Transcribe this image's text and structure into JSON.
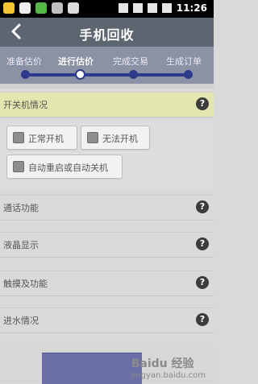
{
  "status_bar": {
    "time": "11:26",
    "left_icons": [
      "app-icon",
      "mail-icon",
      "app-icon",
      "android-icon",
      "usb-icon"
    ],
    "right_icons": [
      "bluetooth-icon",
      "wifi-icon",
      "sim-icon",
      "battery-icon"
    ]
  },
  "header": {
    "title": "手机回收"
  },
  "steps": {
    "items": [
      {
        "label": "准备估价",
        "active": false
      },
      {
        "label": "进行估价",
        "active": true
      },
      {
        "label": "完成交易",
        "active": false
      },
      {
        "label": "生成订单",
        "active": false
      }
    ]
  },
  "sections": [
    {
      "title": "开关机情况",
      "open": true
    },
    {
      "title": "通话功能",
      "open": false
    },
    {
      "title": "液晶显示",
      "open": false
    },
    {
      "title": "触摸及功能",
      "open": false
    },
    {
      "title": "进水情况",
      "open": false
    }
  ],
  "power_options": [
    {
      "label": "正常开机"
    },
    {
      "label": "无法开机"
    },
    {
      "label": "自动重启或自动关机"
    }
  ],
  "help_glyph": "?",
  "watermark": {
    "text": "Baidu 经验",
    "sub": "jingyan.baidu.com"
  },
  "colors": {
    "header_bg": "#5d6570",
    "steps_bg": "#8b92a6",
    "step_line": "#2e3a8a",
    "open_row_bg": "#e2e7b0",
    "bottom_button": "#6a6fa6"
  }
}
